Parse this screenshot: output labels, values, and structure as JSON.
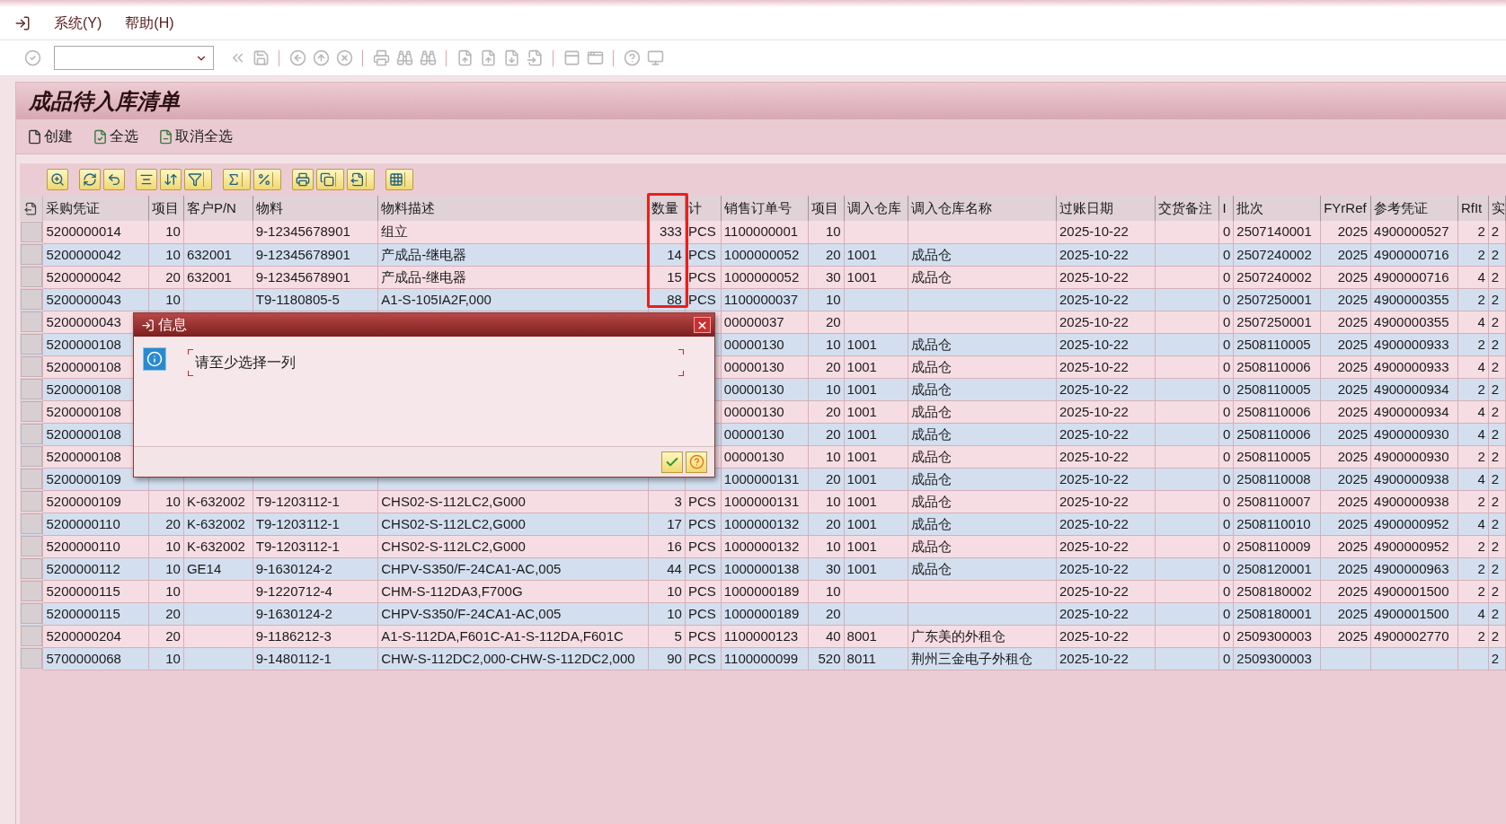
{
  "menu": [
    {
      "label": "系统(Y)"
    },
    {
      "label": "帮助(H)"
    }
  ],
  "title": "成品待入库清单",
  "app_toolbar": [
    {
      "label": "创建"
    },
    {
      "label": "全选"
    },
    {
      "label": "取消全选"
    }
  ],
  "table": {
    "columns": [
      {
        "label": "采购凭证",
        "kind": "text"
      },
      {
        "label": "项目",
        "kind": "number"
      },
      {
        "label": "客户P/N",
        "kind": "text"
      },
      {
        "label": "物料",
        "kind": "text"
      },
      {
        "label": "物料描述",
        "kind": "text"
      },
      {
        "label": "数量",
        "kind": "number"
      },
      {
        "label": "计",
        "kind": "text"
      },
      {
        "label": "销售订单号",
        "kind": "text"
      },
      {
        "label": "项目",
        "kind": "number"
      },
      {
        "label": "调入仓库",
        "kind": "text"
      },
      {
        "label": "调入仓库名称",
        "kind": "text"
      },
      {
        "label": "过账日期",
        "kind": "text"
      },
      {
        "label": "交货备注",
        "kind": "text"
      },
      {
        "label": "I",
        "kind": "number"
      },
      {
        "label": "批次",
        "kind": "text"
      },
      {
        "label": "FYrRef",
        "kind": "number"
      },
      {
        "label": "参考凭证",
        "kind": "text"
      },
      {
        "label": "RfIt",
        "kind": "number"
      },
      {
        "label": "实",
        "kind": "text"
      }
    ],
    "rows": [
      {
        "cells": [
          "5200000014",
          "10",
          null,
          "9-12345678901",
          "组立",
          "333",
          "PCS",
          "1100000001",
          "10",
          null,
          null,
          "2025-10-22",
          null,
          "0",
          "2507140001",
          "2025",
          "4900000527",
          "2",
          "2"
        ]
      },
      {
        "cells": [
          "5200000042",
          "10",
          "632001",
          "9-12345678901",
          "产成品-继电器",
          "14",
          "PCS",
          "1000000052",
          "20",
          "1001",
          "成品仓",
          "2025-10-22",
          null,
          "0",
          "2507240002",
          "2025",
          "4900000716",
          "2",
          "2"
        ]
      },
      {
        "cells": [
          "5200000042",
          "20",
          "632001",
          "9-12345678901",
          "产成品-继电器",
          "15",
          "PCS",
          "1000000052",
          "30",
          "1001",
          "成品仓",
          "2025-10-22",
          null,
          "0",
          "2507240002",
          "2025",
          "4900000716",
          "4",
          "2"
        ]
      },
      {
        "cells": [
          "5200000043",
          "10",
          null,
          "T9-1180805-5",
          "A1-S-105IA2F,000",
          "88",
          "PCS",
          "1100000037",
          "10",
          null,
          null,
          "2025-10-22",
          null,
          "0",
          "2507250001",
          "2025",
          "4900000355",
          "2",
          "2"
        ]
      },
      {
        "cells": [
          "5200000043",
          null,
          null,
          null,
          null,
          null,
          null,
          "00000037",
          "20",
          null,
          null,
          "2025-10-22",
          null,
          "0",
          "2507250001",
          "2025",
          "4900000355",
          "4",
          "2"
        ]
      },
      {
        "cells": [
          "5200000108",
          null,
          null,
          null,
          null,
          null,
          null,
          "00000130",
          "10",
          "1001",
          "成品仓",
          "2025-10-22",
          null,
          "0",
          "2508110005",
          "2025",
          "4900000933",
          "2",
          "2"
        ]
      },
      {
        "cells": [
          "5200000108",
          null,
          null,
          null,
          null,
          null,
          null,
          "00000130",
          "20",
          "1001",
          "成品仓",
          "2025-10-22",
          null,
          "0",
          "2508110006",
          "2025",
          "4900000933",
          "4",
          "2"
        ]
      },
      {
        "cells": [
          "5200000108",
          null,
          null,
          null,
          null,
          null,
          null,
          "00000130",
          "10",
          "1001",
          "成品仓",
          "2025-10-22",
          null,
          "0",
          "2508110005",
          "2025",
          "4900000934",
          "2",
          "2"
        ]
      },
      {
        "cells": [
          "5200000108",
          null,
          null,
          null,
          null,
          null,
          null,
          "00000130",
          "20",
          "1001",
          "成品仓",
          "2025-10-22",
          null,
          "0",
          "2508110006",
          "2025",
          "4900000934",
          "4",
          "2"
        ]
      },
      {
        "cells": [
          "5200000108",
          null,
          null,
          null,
          null,
          null,
          null,
          "00000130",
          "20",
          "1001",
          "成品仓",
          "2025-10-22",
          null,
          "0",
          "2508110006",
          "2025",
          "4900000930",
          "4",
          "2"
        ]
      },
      {
        "cells": [
          "5200000108",
          null,
          null,
          null,
          null,
          null,
          null,
          "00000130",
          "10",
          "1001",
          "成品仓",
          "2025-10-22",
          null,
          "0",
          "2508110005",
          "2025",
          "4900000930",
          "2",
          "2"
        ]
      },
      {
        "cells": [
          "5200000109",
          null,
          null,
          null,
          null,
          null,
          null,
          "1000000131",
          "20",
          "1001",
          "成品仓",
          "2025-10-22",
          null,
          "0",
          "2508110008",
          "2025",
          "4900000938",
          "4",
          "2"
        ]
      },
      {
        "cells": [
          "5200000109",
          "10",
          "K-632002",
          "T9-1203112-1",
          "CHS02-S-112LC2,G000",
          "3",
          "PCS",
          "1000000131",
          "10",
          "1001",
          "成品仓",
          "2025-10-22",
          null,
          "0",
          "2508110007",
          "2025",
          "4900000938",
          "2",
          "2"
        ]
      },
      {
        "cells": [
          "5200000110",
          "20",
          "K-632002",
          "T9-1203112-1",
          "CHS02-S-112LC2,G000",
          "17",
          "PCS",
          "1000000132",
          "20",
          "1001",
          "成品仓",
          "2025-10-22",
          null,
          "0",
          "2508110010",
          "2025",
          "4900000952",
          "4",
          "2"
        ]
      },
      {
        "cells": [
          "5200000110",
          "10",
          "K-632002",
          "T9-1203112-1",
          "CHS02-S-112LC2,G000",
          "16",
          "PCS",
          "1000000132",
          "10",
          "1001",
          "成品仓",
          "2025-10-22",
          null,
          "0",
          "2508110009",
          "2025",
          "4900000952",
          "2",
          "2"
        ]
      },
      {
        "cells": [
          "5200000112",
          "10",
          "GE14",
          "9-1630124-2",
          "CHPV-S350/F-24CA1-AC,005",
          "44",
          "PCS",
          "1000000138",
          "30",
          "1001",
          "成品仓",
          "2025-10-22",
          null,
          "0",
          "2508120001",
          "2025",
          "4900000963",
          "2",
          "2"
        ]
      },
      {
        "cells": [
          "5200000115",
          "10",
          null,
          "9-1220712-4",
          "CHM-S-112DA3,F700G",
          "10",
          "PCS",
          "1000000189",
          "10",
          null,
          null,
          "2025-10-22",
          null,
          "0",
          "2508180002",
          "2025",
          "4900001500",
          "2",
          "2"
        ]
      },
      {
        "cells": [
          "5200000115",
          "20",
          null,
          "9-1630124-2",
          "CHPV-S350/F-24CA1-AC,005",
          "10",
          "PCS",
          "1000000189",
          "20",
          null,
          null,
          "2025-10-22",
          null,
          "0",
          "2508180001",
          "2025",
          "4900001500",
          "4",
          "2"
        ]
      },
      {
        "cells": [
          "5200000204",
          "20",
          null,
          "9-1186212-3",
          "A1-S-112DA,F601C-A1-S-112DA,F601C",
          "5",
          "PCS",
          "1100000123",
          "40",
          "8001",
          "广东美的外租仓",
          "2025-10-22",
          null,
          "0",
          "2509300003",
          "2025",
          "4900002770",
          "2",
          "2"
        ]
      },
      {
        "cells": [
          "5700000068",
          "10",
          null,
          "9-1480112-1",
          "CHW-S-112DC2,000-CHW-S-112DC2,000",
          "90",
          "PCS",
          "1100000099",
          "520",
          "8011",
          "荆州三金电子外租仓",
          "2025-10-22",
          null,
          "0",
          "2509300003",
          null,
          null,
          null,
          "2"
        ]
      }
    ]
  },
  "dialog": {
    "title": "信息",
    "message": "请至少选择一列"
  }
}
